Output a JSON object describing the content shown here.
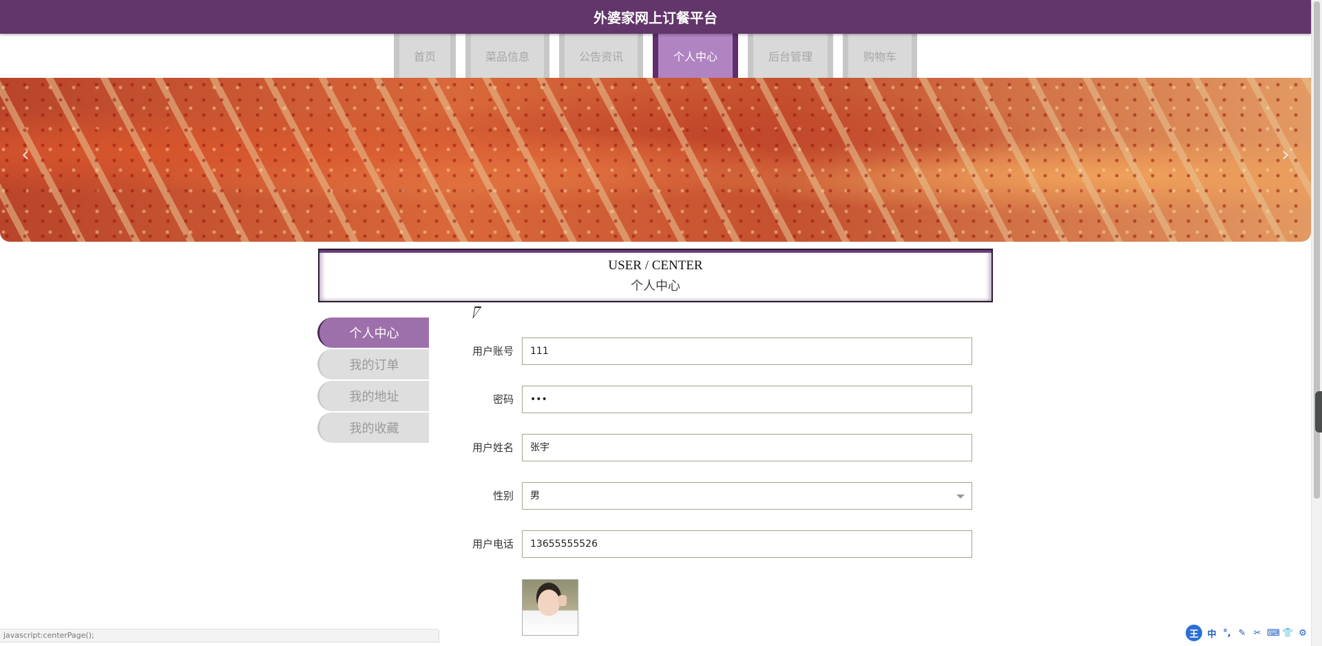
{
  "header": {
    "title": "外婆家网上订餐平台"
  },
  "nav": {
    "tabs": [
      {
        "label": "首页",
        "active": false
      },
      {
        "label": "菜品信息",
        "active": false
      },
      {
        "label": "公告资讯",
        "active": false
      },
      {
        "label": "个人中心",
        "active": true
      },
      {
        "label": "后台管理",
        "active": false
      },
      {
        "label": "购物车",
        "active": false
      }
    ]
  },
  "banner": {
    "prev_icon": "chevron-left-icon",
    "next_icon": "chevron-right-icon",
    "prev_glyph": "‹",
    "next_glyph": "›"
  },
  "section": {
    "title_en": "USER / CENTER",
    "title_cn": "个人中心"
  },
  "side_menu": {
    "items": [
      {
        "label": "个人中心",
        "active": true
      },
      {
        "label": "我的订单",
        "active": false
      },
      {
        "label": "我的地址",
        "active": false
      },
      {
        "label": "我的收藏",
        "active": false
      }
    ]
  },
  "form": {
    "username": {
      "label": "用户账号",
      "value": "111"
    },
    "password": {
      "label": "密码",
      "value": "•••"
    },
    "name": {
      "label": "用户姓名",
      "value": "张宇"
    },
    "gender": {
      "label": "性别",
      "value": "男"
    },
    "phone": {
      "label": "用户电话",
      "value": "13655555526"
    }
  },
  "statusbar": {
    "text": "javascript:centerPage();"
  },
  "ime": {
    "logo": "王",
    "items": [
      "中",
      "°,",
      "✎",
      "✂",
      "⌨",
      "👕",
      "⚙"
    ]
  },
  "colors": {
    "primary": "#62356b",
    "accent": "#b083c2",
    "tab_inactive": "#d9d9d9"
  }
}
